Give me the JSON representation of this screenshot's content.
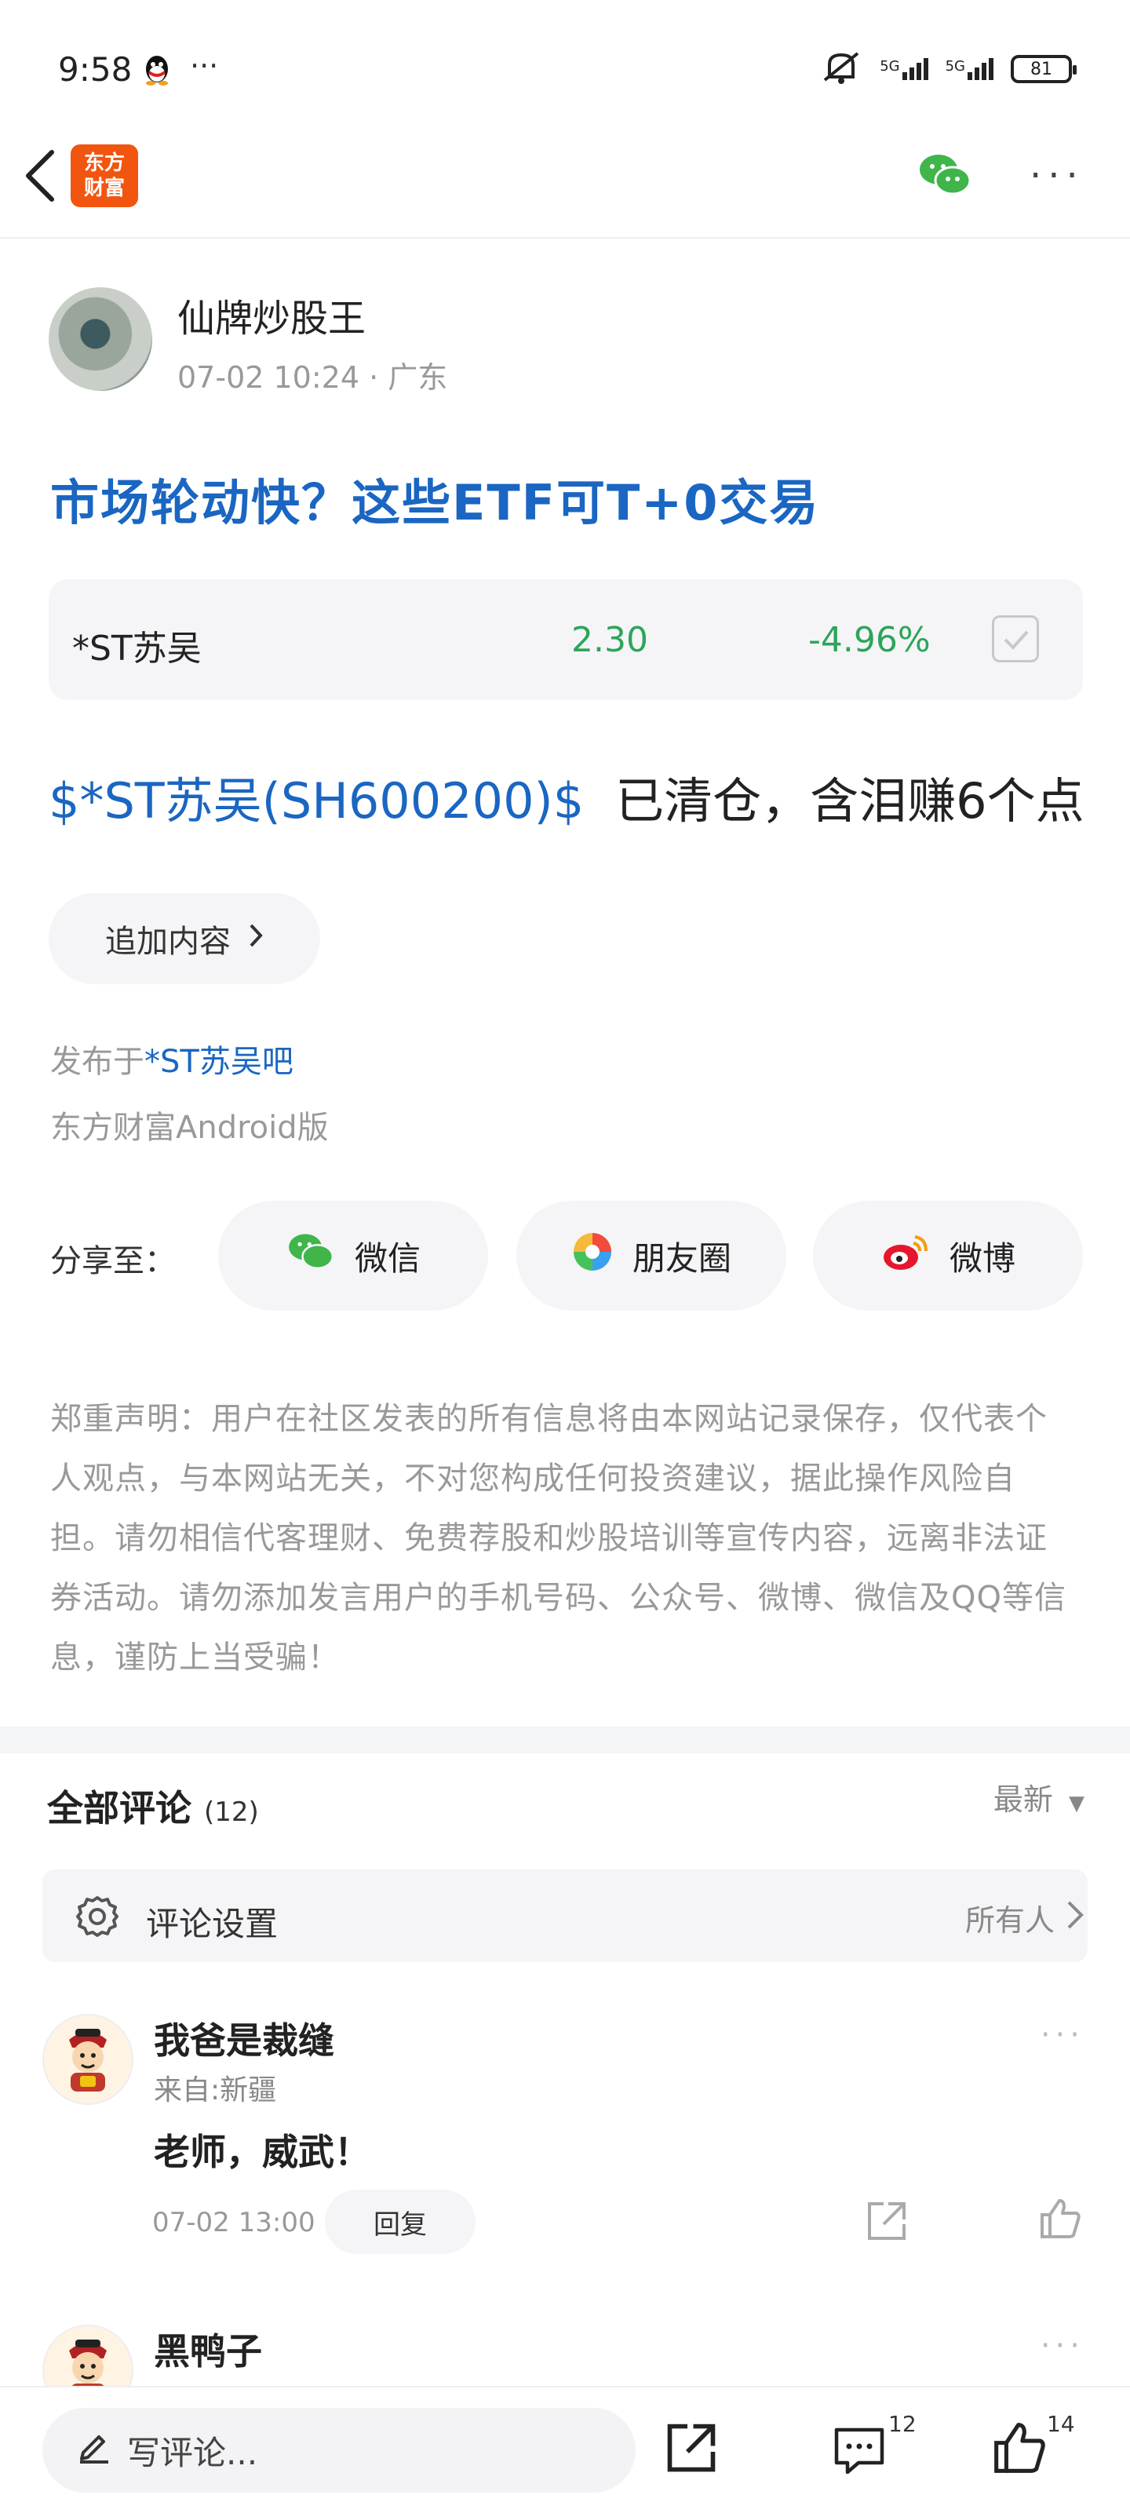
{
  "status_bar": {
    "time": "9:58",
    "more": "···",
    "net1": "5G",
    "net2": "5G",
    "battery": "81"
  },
  "header": {
    "logo_line1": "东方",
    "logo_line2": "财富",
    "more": "···"
  },
  "post": {
    "author": "仙牌炒股王",
    "meta": "07-02 10:24 · 广东",
    "title": "市场轮动快？这些ETF可T+0交易",
    "stock_card": {
      "name": "*ST苏吴",
      "price": "2.30",
      "change": "-4.96%"
    },
    "stock_link": "$*ST苏吴(SH600200)$",
    "body": "已清仓，含泪赚6个点",
    "append_label": "追加内容",
    "published_prefix": "发布于",
    "published_bar": "*ST苏吴吧",
    "platform": "东方财富Android版"
  },
  "share": {
    "label": "分享至：",
    "wechat": "微信",
    "moments": "朋友圈",
    "weibo": "微博"
  },
  "disclaimer": "郑重声明：用户在社区发表的所有信息将由本网站记录保存，仅代表个人观点，与本网站无关，不对您构成任何投资建议，据此操作风险自担。请勿相信代客理财、免费荐股和炒股培训等宣传内容，远离非法证券活动。请勿添加发言用户的手机号码、公众号、微博、微信及QQ等信息，谨防上当受骗！",
  "comments": {
    "title": "全部评论",
    "count": "(12)",
    "sort": "最新",
    "settings_label": "评论设置",
    "settings_value": "所有人",
    "items": [
      {
        "name": "我爸是裁缝",
        "location": "来自:新疆",
        "text": "老师，威武！",
        "time": "07-02 13:00",
        "reply": "回复"
      },
      {
        "name": "黑鸭子"
      }
    ]
  },
  "bottom_bar": {
    "write_placeholder": "写评论...",
    "comment_count": "12",
    "like_count": "14"
  },
  "colors": {
    "link_blue": "#1a66c2",
    "green": "#2da559",
    "logo_orange": "#f2550f"
  }
}
